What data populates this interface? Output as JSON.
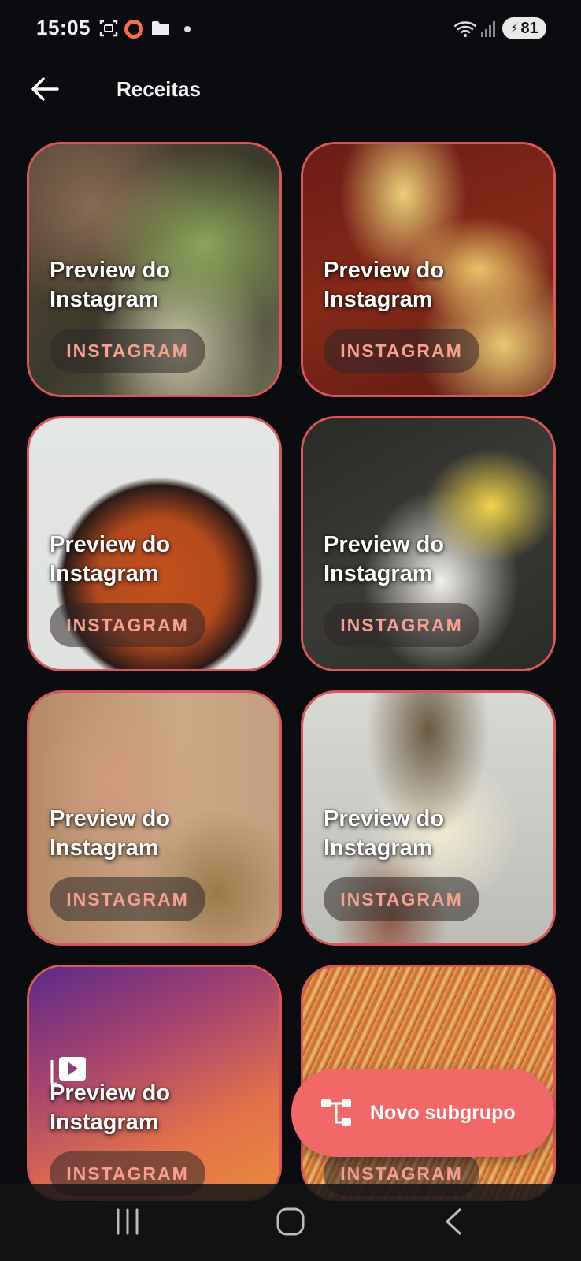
{
  "status_bar": {
    "time": "15:05",
    "battery": "81",
    "icons": [
      "screenshot-icon",
      "record-icon",
      "folder-icon",
      "notification-dot-icon",
      "wifi-icon",
      "signal-icon",
      "battery-icon"
    ]
  },
  "app_bar": {
    "title": "Receitas",
    "back_icon": "arrow-left-icon"
  },
  "cards": [
    {
      "caption": "Preview do Instagram",
      "badge": "INSTAGRAM"
    },
    {
      "caption": "Preview do Instagram",
      "badge": "INSTAGRAM"
    },
    {
      "caption": "Preview do Instagram",
      "badge": "INSTAGRAM"
    },
    {
      "caption": "Preview do Instagram",
      "badge": "INSTAGRAM"
    },
    {
      "caption": "Preview do Instagram",
      "badge": "INSTAGRAM"
    },
    {
      "caption": "Preview do Instagram",
      "badge": "INSTAGRAM"
    },
    {
      "caption": "Preview do Instagram",
      "badge": "INSTAGRAM"
    },
    {
      "caption": "Preview do Instagram",
      "badge": "INSTAGRAM"
    }
  ],
  "fab": {
    "label": "Novo subgrupo",
    "icon": "subgroup-tree-icon"
  },
  "colors": {
    "background": "#0b0c10",
    "accent": "#f26868",
    "card_border": "#d8585a",
    "badge_text": "#f7a090"
  }
}
